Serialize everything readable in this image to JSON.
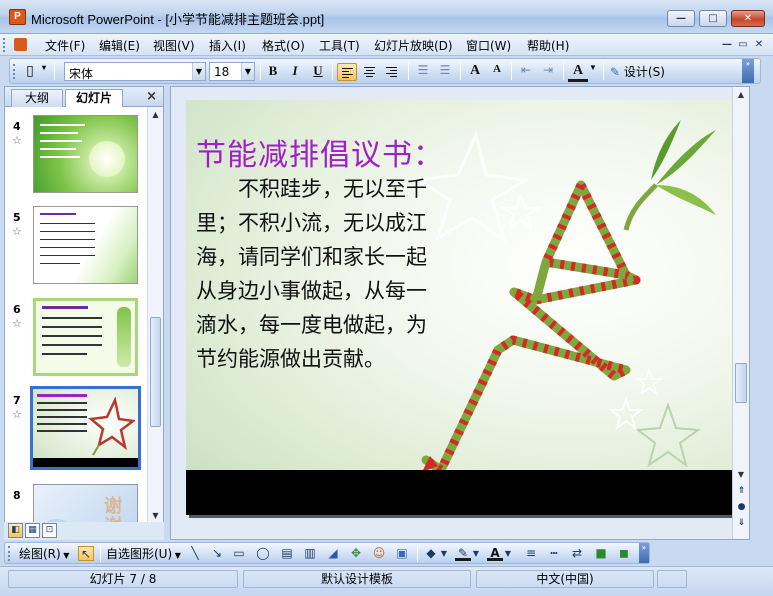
{
  "window": {
    "title": "Microsoft PowerPoint - [小学节能减排主题班会.ppt]",
    "app_icon_letter": "P",
    "minimize": "—",
    "maximize": "□",
    "close": "✕"
  },
  "menu": {
    "items": [
      "文件(F)",
      "编辑(E)",
      "视图(V)",
      "插入(I)",
      "格式(O)",
      "工具(T)",
      "幻灯片放映(D)",
      "窗口(W)",
      "帮助(H)"
    ],
    "mdi_minimize": "—",
    "mdi_restore": "▭",
    "mdi_close": "✕"
  },
  "toolbar": {
    "font_name": "宋体",
    "font_size": "18",
    "bold": "B",
    "italic": "I",
    "underline": "U",
    "grow_font": "A",
    "shrink_font": "A",
    "font_color": "A",
    "design_label": "设计(S)"
  },
  "panel": {
    "tab_outline": "大纲",
    "tab_slides": "幻灯片",
    "close": "×",
    "slides": [
      {
        "num": "4",
        "star": "☆"
      },
      {
        "num": "5",
        "star": "☆"
      },
      {
        "num": "6",
        "star": "☆"
      },
      {
        "num": "7",
        "star": "☆"
      },
      {
        "num": "8",
        "star": ""
      }
    ],
    "slide8_text": "谢谢"
  },
  "slide": {
    "title": "节能减排倡议书：",
    "body_lines": [
      "　　不积跬步，无以至千",
      "里；不积小流，无以成江",
      "海，请同学们和家长一起",
      "从身边小事做起，从每一",
      "滴水，每一度电做起，为",
      "节约能源做出贡献。"
    ]
  },
  "drawbar": {
    "draw_label": "绘图(R)",
    "autoshapes_label": "自选图形(U)"
  },
  "status": {
    "slide_info": "幻灯片 7 / 8",
    "template": "默认设计模板",
    "language": "中文(中国)"
  }
}
